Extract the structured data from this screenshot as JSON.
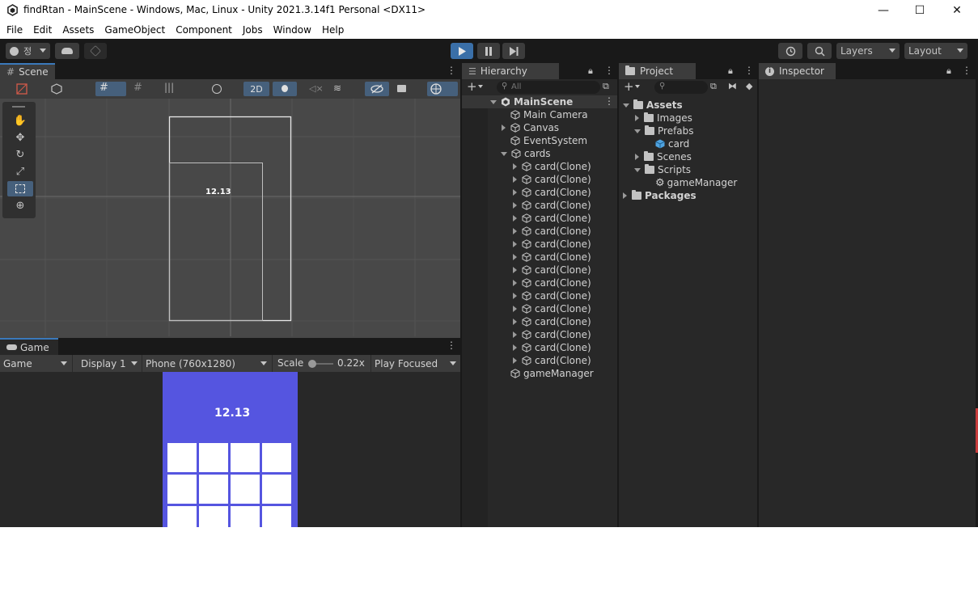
{
  "window": {
    "title": "findRtan - MainScene - Windows, Mac, Linux - Unity 2021.3.14f1 Personal <DX11>",
    "minimize": "—",
    "maximize": "☐",
    "close": "✕"
  },
  "menu": [
    "File",
    "Edit",
    "Assets",
    "GameObject",
    "Component",
    "Jobs",
    "Window",
    "Help"
  ],
  "toolbar": {
    "account_initial": "정",
    "play_icon": "play-icon",
    "pause_icon": "pause-icon",
    "step_icon": "step-icon",
    "layers_label": "Layers",
    "layout_label": "Layout"
  },
  "scene": {
    "tab_label": "Scene",
    "mode_2d": "2D",
    "preview_text": "12.13"
  },
  "game": {
    "tab_label": "Game",
    "view_select": "Game",
    "display_select": "Display 1",
    "resolution_select": "Phone (760x1280)",
    "scale_label": "Scale",
    "scale_value": "0.22x",
    "play_focused": "Play Focused",
    "timer_text": "12.13",
    "background_color": "#5555e0"
  },
  "hierarchy": {
    "tab_label": "Hierarchy",
    "search_placeholder": "All",
    "scene_name": "MainScene",
    "items": {
      "main_camera": "Main Camera",
      "canvas": "Canvas",
      "event_system": "EventSystem",
      "cards": "cards",
      "clones": [
        "card(Clone)",
        "card(Clone)",
        "card(Clone)",
        "card(Clone)",
        "card(Clone)",
        "card(Clone)",
        "card(Clone)",
        "card(Clone)",
        "card(Clone)",
        "card(Clone)",
        "card(Clone)",
        "card(Clone)",
        "card(Clone)",
        "card(Clone)",
        "card(Clone)",
        "card(Clone)"
      ],
      "game_manager": "gameManager"
    }
  },
  "project": {
    "tab_label": "Project",
    "assets": "Assets",
    "images": "Images",
    "prefabs": "Prefabs",
    "card": "card",
    "scenes": "Scenes",
    "scripts": "Scripts",
    "game_manager_script": "gameManager",
    "packages": "Packages"
  },
  "inspector": {
    "tab_label": "Inspector"
  }
}
